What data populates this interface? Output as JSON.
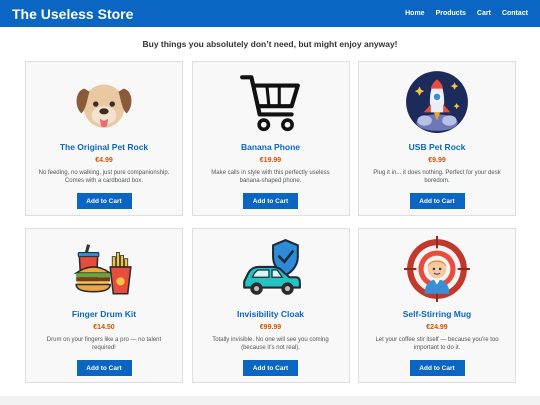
{
  "header": {
    "brand": "The Useless Store",
    "nav": [
      "Home",
      "Products",
      "Cart",
      "Contact"
    ]
  },
  "tagline": "Buy things you absolutely don’t need, but might enjoy anyway!",
  "products": [
    {
      "name": "The Original Pet Rock",
      "price": "€4.99",
      "description": "No feeding, no walking, just pure companionship. Comes with a cardboard box.",
      "button": "Add to Cart",
      "icon": "dog-icon"
    },
    {
      "name": "Banana Phone",
      "price": "€19.99",
      "description": "Make calls in style with this perfectly useless banana-shaped phone.",
      "button": "Add to Cart",
      "icon": "shopping-cart-icon"
    },
    {
      "name": "USB Pet Rock",
      "price": "€9.99",
      "description": "Plug it in... it does nothing. Perfect for your desk boredom.",
      "button": "Add to Cart",
      "icon": "rocket-icon"
    },
    {
      "name": "Finger Drum Kit",
      "price": "€14.50",
      "description": "Drum on your fingers like a pro — no talent required!",
      "button": "Add to Cart",
      "icon": "fast-food-icon"
    },
    {
      "name": "Invisibility Cloak",
      "price": "€99.99",
      "description": "Totally invisible. No one will see you coming (because it's not real).",
      "button": "Add to Cart",
      "icon": "car-shield-icon"
    },
    {
      "name": "Self-Stirring Mug",
      "price": "€24.99",
      "description": "Let your coffee stir itself — because you're too important to do it.",
      "button": "Add to Cart",
      "icon": "target-person-icon"
    }
  ],
  "colors": {
    "primary": "#0a66c2",
    "price": "#d35400"
  }
}
